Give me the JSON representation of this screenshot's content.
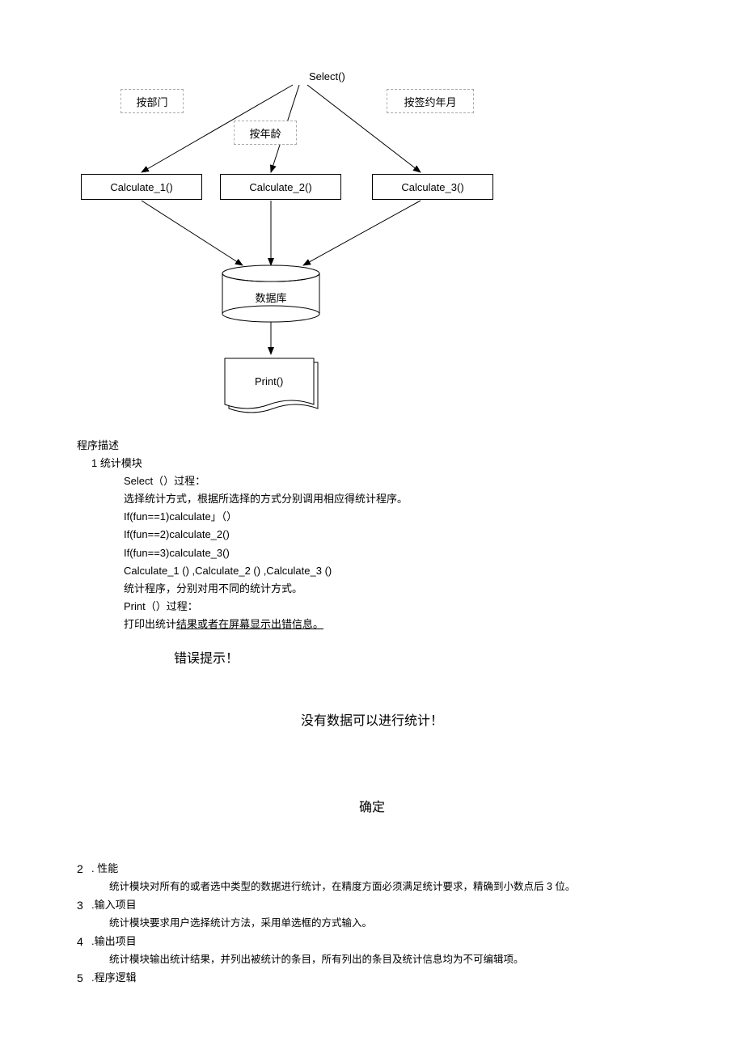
{
  "diagram": {
    "top_label": "Select()",
    "branches": {
      "by_dept": "按部门",
      "by_age": "按年龄",
      "by_contract": "按签约年月"
    },
    "calc1": "Calculate_1()",
    "calc2": "Calculate_2()",
    "calc3": "Calculate_3()",
    "database": "数据库",
    "print": "Print()"
  },
  "desc": {
    "title": "程序描述",
    "section1_title": "1 统计模块",
    "select_proc": "Select（）过程：",
    "select_desc": "选择统计方式，根据所选择的方式分别调用相应得统计程序。",
    "if1": "If(fun==1)calculate」（）",
    "if2": "If(fun==2)calculate_2()",
    "if3": "If(fun==3)calculate_3()",
    "calc_list": "Calculate_1 () ,Calculate_2 () ,Calculate_3 ()",
    "calc_desc": "统计程序，分别对用不同的统计方式。",
    "print_proc": "Print（）过程：",
    "print_desc_prefix": "打印出统计",
    "print_desc_underline": "结果或者在屏幕显示出错信息。",
    "error_title": "错误提示！",
    "error_msg": "没有数据可以进行统计！",
    "confirm": "确定",
    "item2_num": "2",
    "item2_label": ". 性能",
    "item2_detail": "统计模块对所有的或者选中类型的数据进行统计，在精度方面必须满足统计要求，精确到小数点后 3 位。",
    "item3_num": "3",
    "item3_label": " .输入项目",
    "item3_detail": "统计模块要求用户选择统计方法，采用单选框的方式输入。",
    "item4_num": "4",
    "item4_label": " .输出项目",
    "item4_detail": "统计模块输出统计结果，并列出被统计的条目，所有列出的条目及统计信息均为不可编辑项。",
    "item5_num": "5",
    "item5_label": " .程序逻辑"
  }
}
